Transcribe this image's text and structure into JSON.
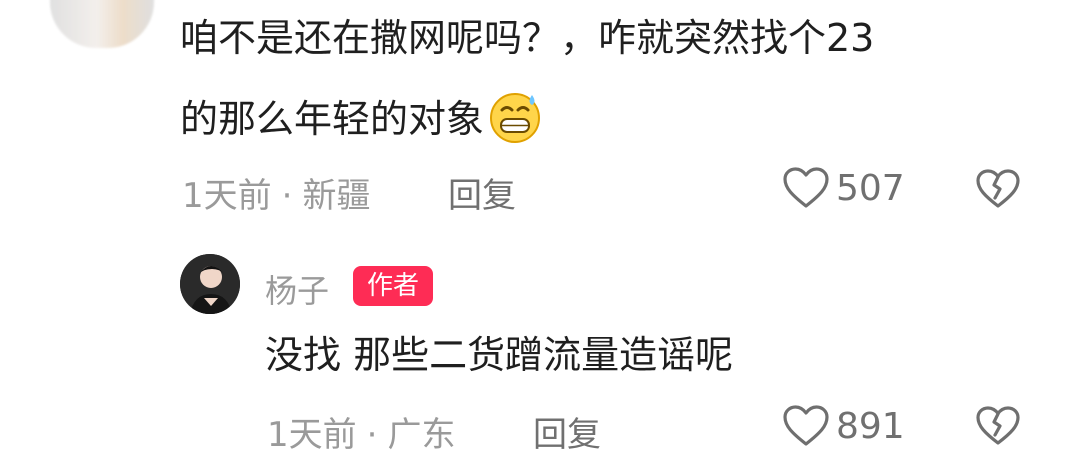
{
  "comment": {
    "line1": "咱不是还在撒网呢吗？，咋就突然找个23",
    "line2": "的那么年轻的对象",
    "emoji": "sweat-grin-emoji",
    "time": "1天前",
    "location": "新疆",
    "dot": "·",
    "reply_label": "回复",
    "likes": "507"
  },
  "reply": {
    "author": "杨子",
    "badge": "作者",
    "text": "没找 那些二货蹭流量造谣呢",
    "time": "1天前",
    "location": "广东",
    "dot": "·",
    "reply_label": "回复",
    "likes": "891"
  },
  "colors": {
    "badge_bg": "#fe2c55",
    "text": "#1f1f1f",
    "meta": "#9a9a9a"
  }
}
